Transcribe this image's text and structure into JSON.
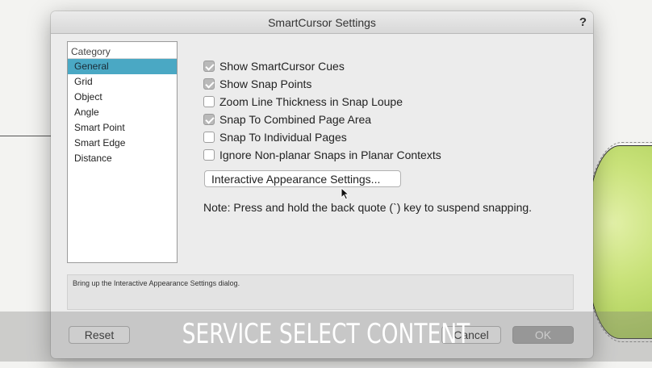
{
  "dialog": {
    "title": "SmartCursor Settings",
    "help_icon": "?"
  },
  "category": {
    "header": "Category",
    "items": [
      {
        "label": "General",
        "selected": true
      },
      {
        "label": "Grid",
        "selected": false
      },
      {
        "label": "Object",
        "selected": false
      },
      {
        "label": "Angle",
        "selected": false
      },
      {
        "label": "Smart Point",
        "selected": false
      },
      {
        "label": "Smart Edge",
        "selected": false
      },
      {
        "label": "Distance",
        "selected": false
      }
    ]
  },
  "options": [
    {
      "label": "Show SmartCursor Cues",
      "checked": true
    },
    {
      "label": "Show Snap Points",
      "checked": true
    },
    {
      "label": "Zoom Line Thickness in Snap Loupe",
      "checked": false
    },
    {
      "label": "Snap To Combined Page Area",
      "checked": true
    },
    {
      "label": "Snap To Individual Pages",
      "checked": false
    },
    {
      "label": "Ignore Non-planar Snaps in Planar Contexts",
      "checked": false
    }
  ],
  "appearance_button": "Interactive Appearance Settings...",
  "note": "Note: Press and hold the back quote (`) key to suspend snapping.",
  "help_text": "Bring up the Interactive Appearance Settings dialog.",
  "footer": {
    "reset": "Reset",
    "cancel": "Cancel",
    "ok": "OK"
  },
  "watermark": "SERVICE SELECT CONTENT",
  "colors": {
    "selection": "#4aa8c4",
    "dialog_bg": "#ececec",
    "blob": "#c9e27a"
  }
}
